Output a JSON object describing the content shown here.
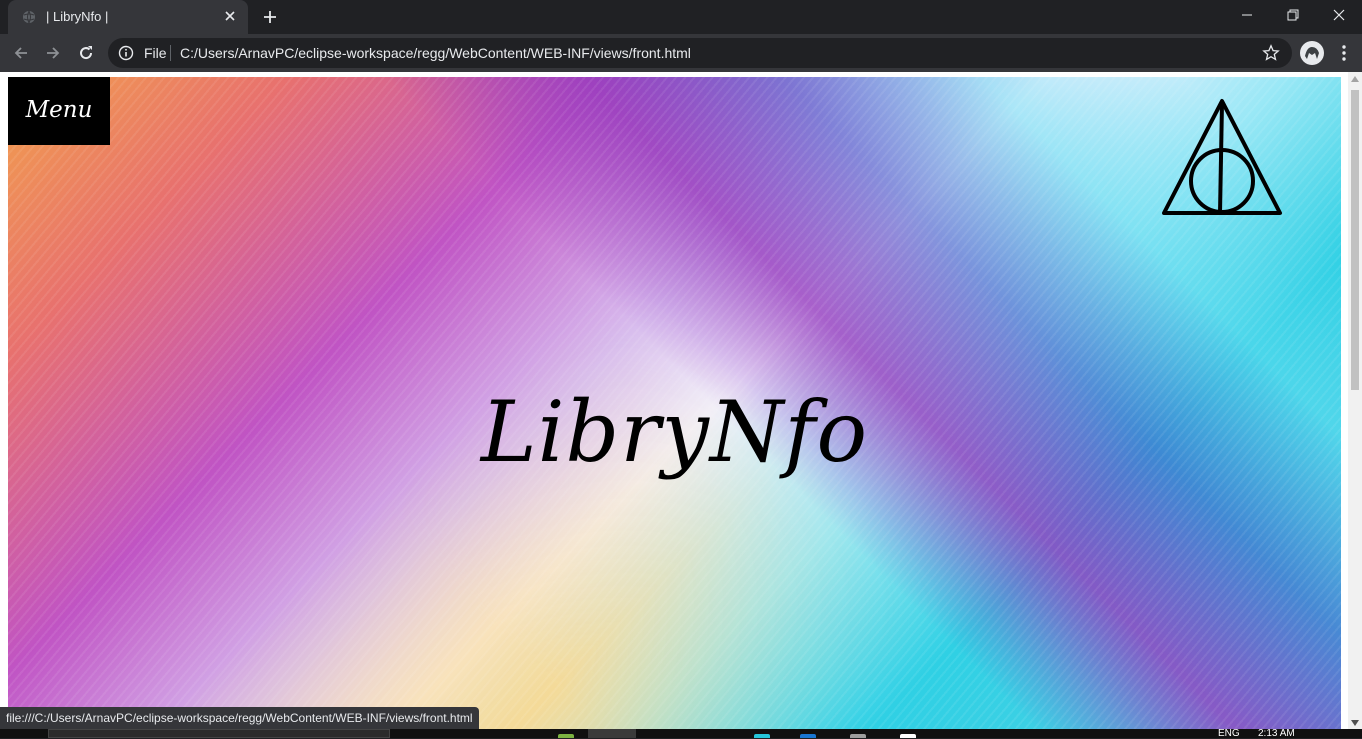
{
  "tab": {
    "title": "| LibryNfo |"
  },
  "toolbar": {
    "scheme_label": "File",
    "url": "C:/Users/ArnavPC/eclipse-workspace/regg/WebContent/WEB-INF/views/front.html"
  },
  "page": {
    "menu_label": "Menu",
    "brand_title": "LibryNfo",
    "logo_icon": "deathly-hallows-icon"
  },
  "status": {
    "link_preview": "file:///C:/Users/ArnavPC/eclipse-workspace/regg/WebContent/WEB-INF/views/front.html"
  },
  "taskbar": {
    "lang": "ENG",
    "clock": "2:13 AM"
  },
  "colors": {
    "chrome_dark": "#202124",
    "chrome_toolbar": "#35363a",
    "menu_bg": "#000000"
  }
}
